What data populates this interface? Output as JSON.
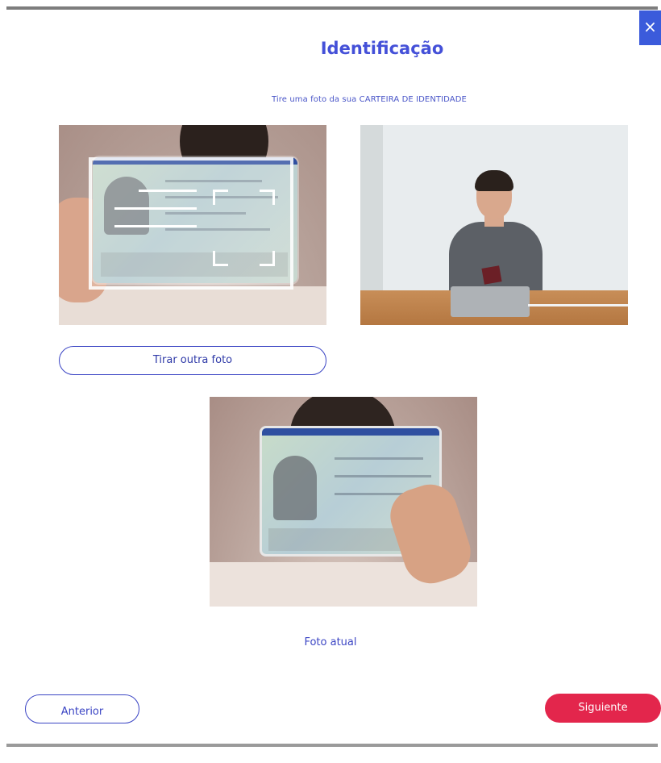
{
  "dialog": {
    "title": "Identificação",
    "subtitle": "Tire uma foto da sua CARTEIRA DE IDENTIDADE",
    "close_icon": "×"
  },
  "buttons": {
    "retake": "Tirar outra foto",
    "previous": "Anterior",
    "next": "Siguiente"
  },
  "current_photo_label": "Foto atual",
  "colors": {
    "primary": "#3b45c4",
    "title": "#4450d8",
    "next_button": "#e3264c",
    "close_button": "#3b5bdb"
  },
  "icons": {
    "close": "close-icon",
    "scan_frame": "scan-frame-icon"
  }
}
